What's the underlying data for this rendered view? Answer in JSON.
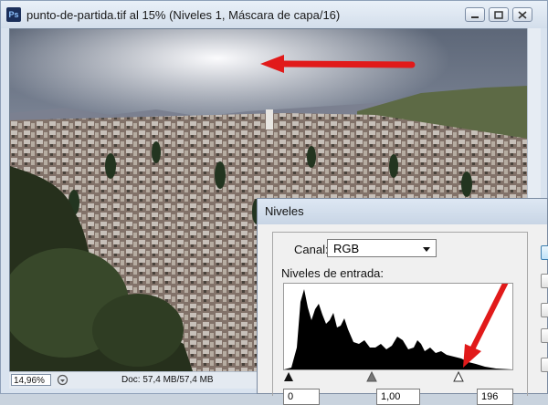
{
  "document": {
    "title": "punto-de-partida.tif al 15% (Niveles 1, Máscara de capa/16)",
    "app_icon_text": "Ps",
    "zoom": "14,96%",
    "doc_size": "Doc: 57,4 MB/57,4 MB"
  },
  "levels": {
    "title": "Niveles",
    "canal_label": "Canal:",
    "canal_value": "RGB",
    "entrada_label": "Niveles de entrada:",
    "input_black": "0",
    "input_gamma": "1,00",
    "input_white": "196"
  },
  "colors": {
    "arrow": "#e11a1a",
    "titlebar": "#d3deeb"
  },
  "icons": [
    "photoshop-icon",
    "minimize-icon",
    "maximize-icon",
    "close-icon",
    "dropdown-caret-icon",
    "black-point-slider-icon",
    "gamma-slider-icon",
    "white-point-slider-icon"
  ]
}
